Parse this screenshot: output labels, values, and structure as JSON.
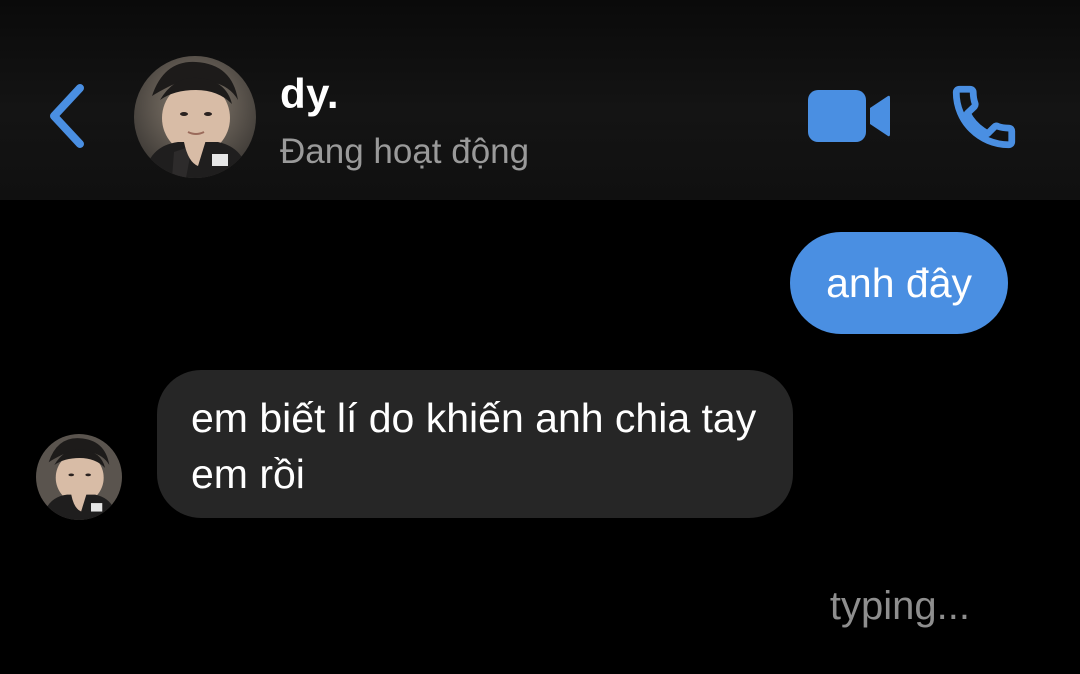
{
  "header": {
    "contact_name": "dy.",
    "status": "Đang hoạt động",
    "icons": {
      "back": "chevron-left-icon",
      "video": "video-camera-icon",
      "call": "phone-icon"
    },
    "accent_color": "#4a8fe2"
  },
  "messages": [
    {
      "direction": "outgoing",
      "text": "anh đây",
      "bubble_color": "#4a8fe2"
    },
    {
      "direction": "incoming",
      "text": "em biết lí do khiến anh chia tay em rồi",
      "bubble_color": "#262626"
    }
  ],
  "typing_indicator": "typing..."
}
